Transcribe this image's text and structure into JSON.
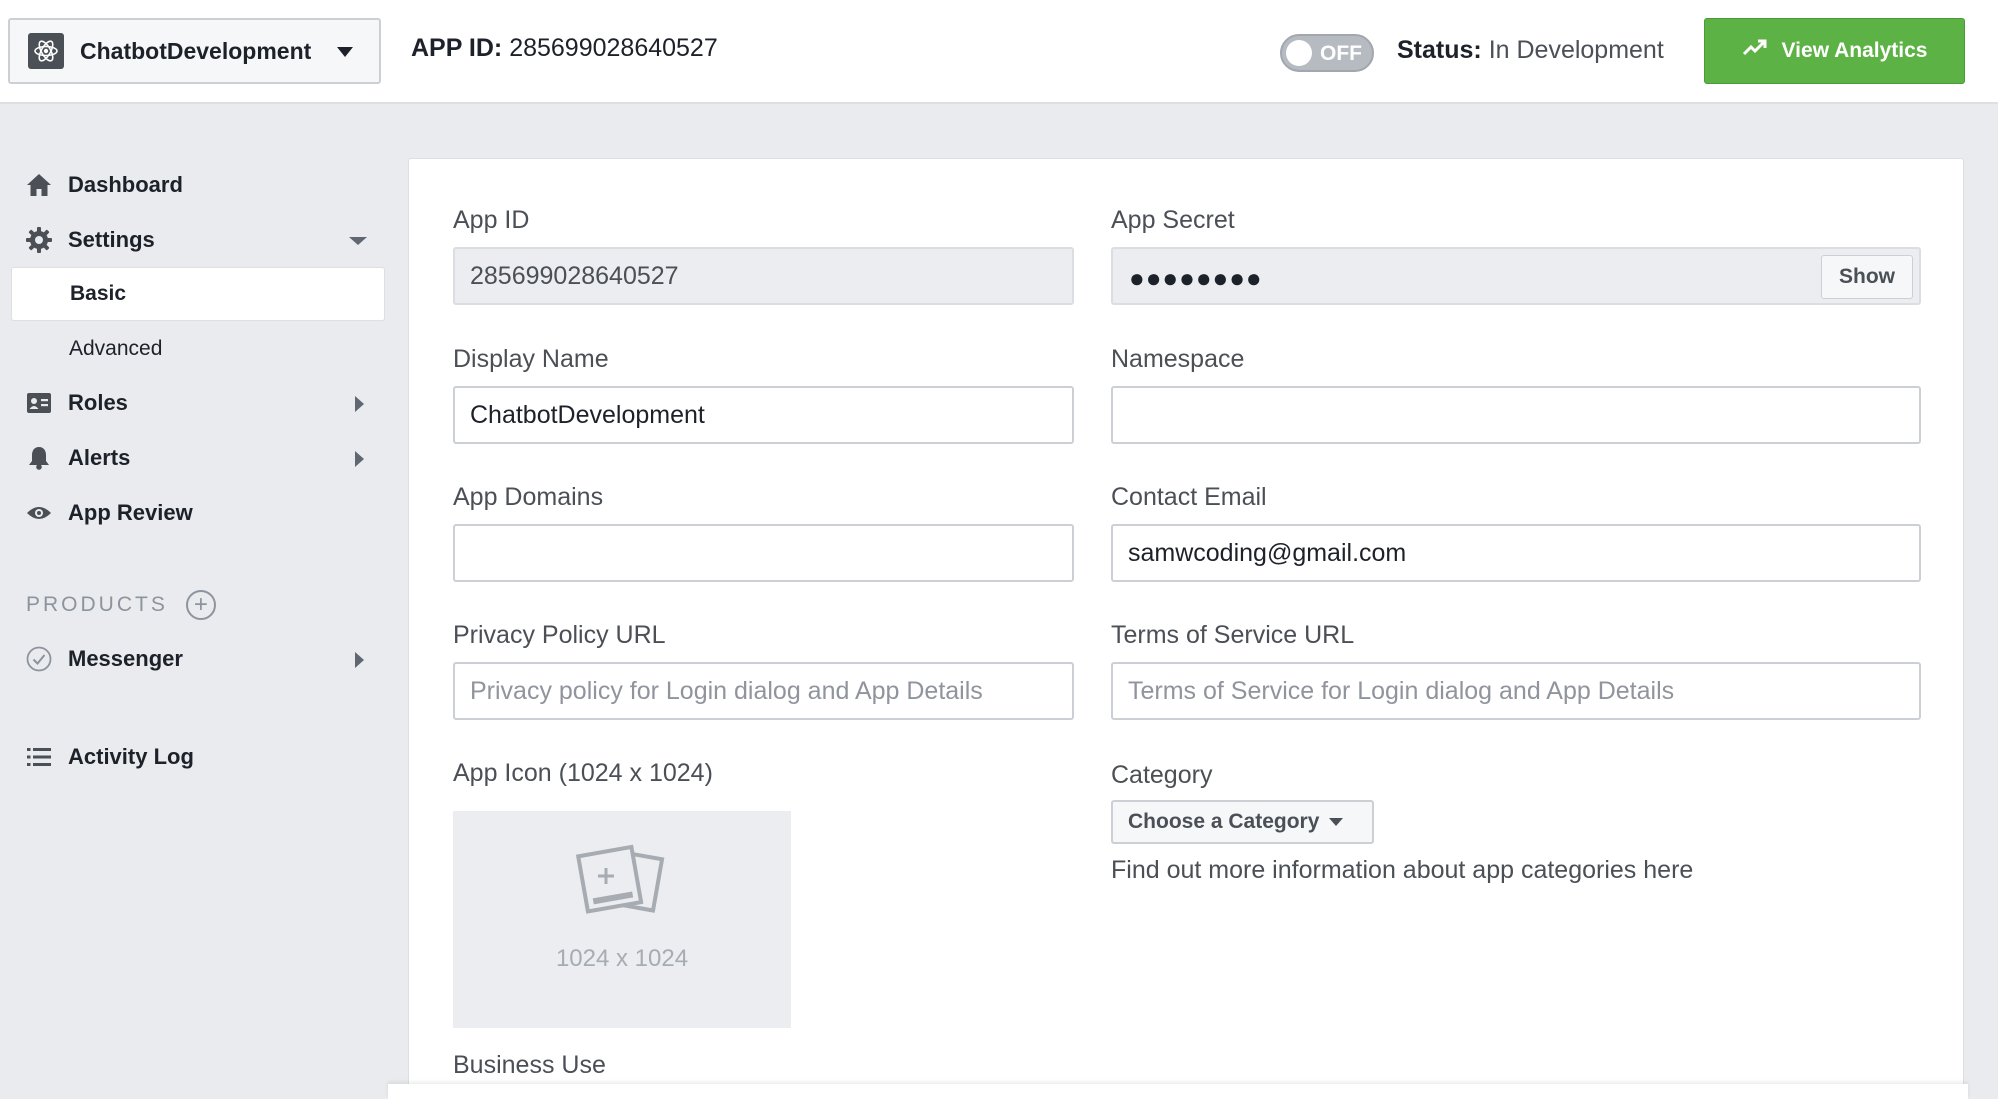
{
  "header": {
    "app_selector": {
      "name": "ChatbotDevelopment",
      "icon": "atom-icon"
    },
    "app_id_label": "APP ID:",
    "app_id_value": "285699028640527",
    "toggle_label": "OFF",
    "status_label": "Status:",
    "status_value": "In Development",
    "analytics_button": {
      "label": "View Analytics",
      "icon": "trend-up-icon",
      "color": "#5cb244"
    }
  },
  "sidebar": {
    "items": [
      {
        "label": "Dashboard",
        "icon": "home-icon"
      },
      {
        "label": "Settings",
        "icon": "gear-icon"
      },
      {
        "label": "Roles",
        "icon": "id-card-icon"
      },
      {
        "label": "Alerts",
        "icon": "bell-icon"
      },
      {
        "label": "App Review",
        "icon": "eye-icon"
      }
    ],
    "settings_sub": [
      {
        "label": "Basic",
        "active": true
      },
      {
        "label": "Advanced",
        "active": false
      }
    ],
    "products_heading": "PRODUCTS",
    "products": [
      {
        "label": "Messenger",
        "icon": "check-circle-icon"
      }
    ],
    "activity_log": {
      "label": "Activity Log",
      "icon": "list-icon"
    }
  },
  "form": {
    "app_id": {
      "label": "App ID",
      "value": "285699028640527"
    },
    "app_secret": {
      "label": "App Secret",
      "masked_value": "●●●●●●●●",
      "show_button": "Show"
    },
    "display_name": {
      "label": "Display Name",
      "value": "ChatbotDevelopment"
    },
    "namespace": {
      "label": "Namespace",
      "value": ""
    },
    "app_domains": {
      "label": "App Domains",
      "value": ""
    },
    "contact_email": {
      "label": "Contact Email",
      "value": "samwcoding@gmail.com"
    },
    "privacy_policy_url": {
      "label": "Privacy Policy URL",
      "placeholder": "Privacy policy for Login dialog and App Details"
    },
    "terms_of_service_url": {
      "label": "Terms of Service URL",
      "placeholder": "Terms of Service for Login dialog and App Details"
    },
    "app_icon": {
      "label": "App Icon (1024 x 1024)",
      "size_text": "1024 x 1024"
    },
    "category": {
      "label": "Category",
      "button": "Choose a Category",
      "info_text": "Find out more information about app categories",
      "info_link": "here"
    },
    "business_use": {
      "label": "Business Use"
    }
  }
}
